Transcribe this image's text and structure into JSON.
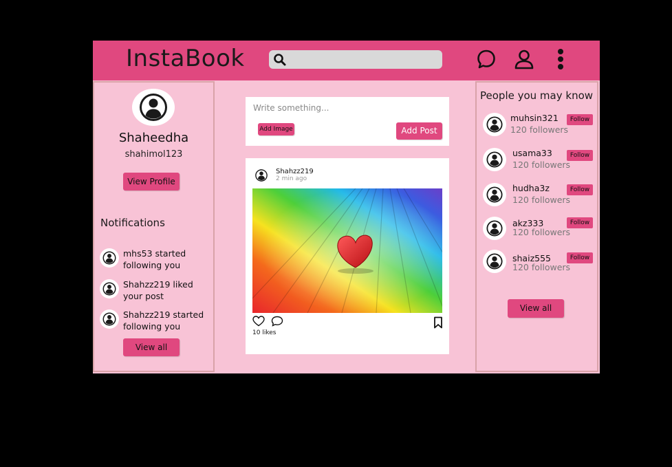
{
  "app": {
    "title": "InstaBook"
  },
  "search": {
    "placeholder": ""
  },
  "top_icons": [
    "chat-icon",
    "user-icon",
    "more-vertical-icon"
  ],
  "colors": {
    "accent": "#e0487f",
    "background": "#f8c3d6",
    "border": "#d9a2a8",
    "search": "#d9d9d9"
  },
  "profile": {
    "name": "Shaheedha",
    "username": "shahimol123",
    "view_profile_label": "View Profile"
  },
  "notifications": {
    "title": "Notifications",
    "items": [
      {
        "text": "mhs53 started following you"
      },
      {
        "text": "Shahzz219 liked your post"
      },
      {
        "text": "Shahzz219 started following you"
      }
    ],
    "view_all_label": "View all"
  },
  "composer": {
    "placeholder": "Write something...",
    "add_image_label": "Add Image",
    "add_post_label": "Add Post"
  },
  "post": {
    "author": "Shahzz219",
    "time": "2 min ago",
    "likes": "10 likes"
  },
  "suggestions": {
    "title": "People you may know",
    "items": [
      {
        "name": "muhsin321",
        "followers": "120 followers",
        "follow_label": "Follow"
      },
      {
        "name": "usama33",
        "followers": "120 followers",
        "follow_label": "Follow"
      },
      {
        "name": "hudha3z",
        "followers": "120 followers",
        "follow_label": "Follow"
      },
      {
        "name": "akz333",
        "followers": "120 followers",
        "follow_label": "Follow"
      },
      {
        "name": "shaiz555",
        "followers": "120 followers",
        "follow_label": "Follow"
      }
    ],
    "view_all_label": "View all"
  }
}
